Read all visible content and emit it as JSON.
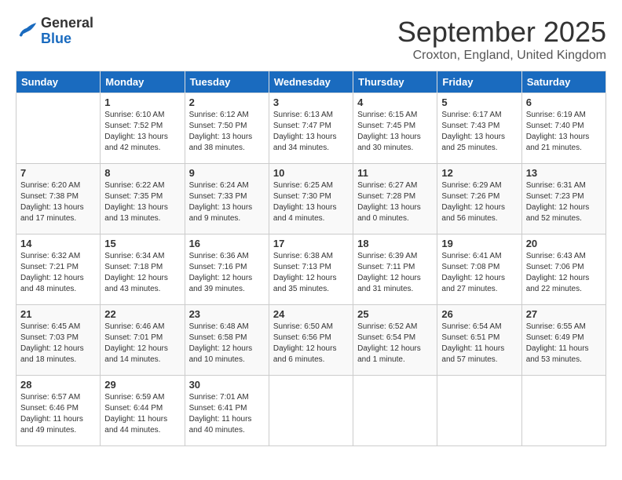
{
  "header": {
    "logo": {
      "general": "General",
      "blue": "Blue"
    },
    "title": "September 2025",
    "subtitle": "Croxton, England, United Kingdom"
  },
  "weekdays": [
    "Sunday",
    "Monday",
    "Tuesday",
    "Wednesday",
    "Thursday",
    "Friday",
    "Saturday"
  ],
  "weeks": [
    [
      {
        "day": null
      },
      {
        "day": 1,
        "sunrise": "6:10 AM",
        "sunset": "7:52 PM",
        "daylight": "13 hours and 42 minutes."
      },
      {
        "day": 2,
        "sunrise": "6:12 AM",
        "sunset": "7:50 PM",
        "daylight": "13 hours and 38 minutes."
      },
      {
        "day": 3,
        "sunrise": "6:13 AM",
        "sunset": "7:47 PM",
        "daylight": "13 hours and 34 minutes."
      },
      {
        "day": 4,
        "sunrise": "6:15 AM",
        "sunset": "7:45 PM",
        "daylight": "13 hours and 30 minutes."
      },
      {
        "day": 5,
        "sunrise": "6:17 AM",
        "sunset": "7:43 PM",
        "daylight": "13 hours and 25 minutes."
      },
      {
        "day": 6,
        "sunrise": "6:19 AM",
        "sunset": "7:40 PM",
        "daylight": "13 hours and 21 minutes."
      }
    ],
    [
      {
        "day": 7,
        "sunrise": "6:20 AM",
        "sunset": "7:38 PM",
        "daylight": "13 hours and 17 minutes."
      },
      {
        "day": 8,
        "sunrise": "6:22 AM",
        "sunset": "7:35 PM",
        "daylight": "13 hours and 13 minutes."
      },
      {
        "day": 9,
        "sunrise": "6:24 AM",
        "sunset": "7:33 PM",
        "daylight": "13 hours and 9 minutes."
      },
      {
        "day": 10,
        "sunrise": "6:25 AM",
        "sunset": "7:30 PM",
        "daylight": "13 hours and 4 minutes."
      },
      {
        "day": 11,
        "sunrise": "6:27 AM",
        "sunset": "7:28 PM",
        "daylight": "13 hours and 0 minutes."
      },
      {
        "day": 12,
        "sunrise": "6:29 AM",
        "sunset": "7:26 PM",
        "daylight": "12 hours and 56 minutes."
      },
      {
        "day": 13,
        "sunrise": "6:31 AM",
        "sunset": "7:23 PM",
        "daylight": "12 hours and 52 minutes."
      }
    ],
    [
      {
        "day": 14,
        "sunrise": "6:32 AM",
        "sunset": "7:21 PM",
        "daylight": "12 hours and 48 minutes."
      },
      {
        "day": 15,
        "sunrise": "6:34 AM",
        "sunset": "7:18 PM",
        "daylight": "12 hours and 43 minutes."
      },
      {
        "day": 16,
        "sunrise": "6:36 AM",
        "sunset": "7:16 PM",
        "daylight": "12 hours and 39 minutes."
      },
      {
        "day": 17,
        "sunrise": "6:38 AM",
        "sunset": "7:13 PM",
        "daylight": "12 hours and 35 minutes."
      },
      {
        "day": 18,
        "sunrise": "6:39 AM",
        "sunset": "7:11 PM",
        "daylight": "12 hours and 31 minutes."
      },
      {
        "day": 19,
        "sunrise": "6:41 AM",
        "sunset": "7:08 PM",
        "daylight": "12 hours and 27 minutes."
      },
      {
        "day": 20,
        "sunrise": "6:43 AM",
        "sunset": "7:06 PM",
        "daylight": "12 hours and 22 minutes."
      }
    ],
    [
      {
        "day": 21,
        "sunrise": "6:45 AM",
        "sunset": "7:03 PM",
        "daylight": "12 hours and 18 minutes."
      },
      {
        "day": 22,
        "sunrise": "6:46 AM",
        "sunset": "7:01 PM",
        "daylight": "12 hours and 14 minutes."
      },
      {
        "day": 23,
        "sunrise": "6:48 AM",
        "sunset": "6:58 PM",
        "daylight": "12 hours and 10 minutes."
      },
      {
        "day": 24,
        "sunrise": "6:50 AM",
        "sunset": "6:56 PM",
        "daylight": "12 hours and 6 minutes."
      },
      {
        "day": 25,
        "sunrise": "6:52 AM",
        "sunset": "6:54 PM",
        "daylight": "12 hours and 1 minute."
      },
      {
        "day": 26,
        "sunrise": "6:54 AM",
        "sunset": "6:51 PM",
        "daylight": "11 hours and 57 minutes."
      },
      {
        "day": 27,
        "sunrise": "6:55 AM",
        "sunset": "6:49 PM",
        "daylight": "11 hours and 53 minutes."
      }
    ],
    [
      {
        "day": 28,
        "sunrise": "6:57 AM",
        "sunset": "6:46 PM",
        "daylight": "11 hours and 49 minutes."
      },
      {
        "day": 29,
        "sunrise": "6:59 AM",
        "sunset": "6:44 PM",
        "daylight": "11 hours and 44 minutes."
      },
      {
        "day": 30,
        "sunrise": "7:01 AM",
        "sunset": "6:41 PM",
        "daylight": "11 hours and 40 minutes."
      },
      {
        "day": null
      },
      {
        "day": null
      },
      {
        "day": null
      },
      {
        "day": null
      }
    ]
  ]
}
